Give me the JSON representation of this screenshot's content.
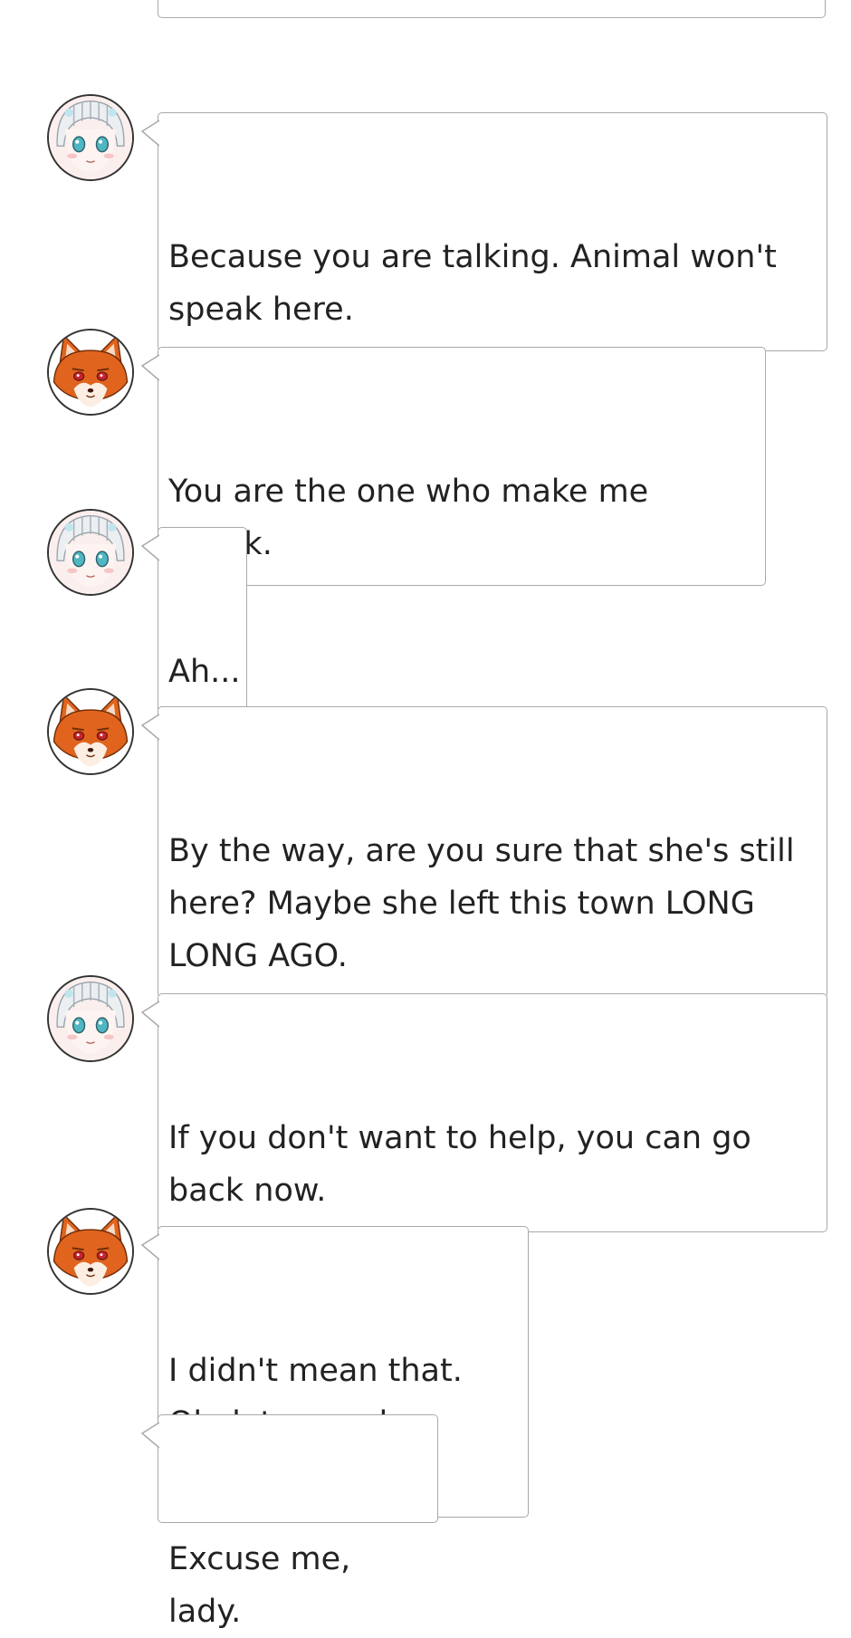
{
  "colors": {
    "bubble_border": "#a9a9a9",
    "text": "#222222",
    "avatar_ring": "#333333",
    "fox_orange": "#e0641e"
  },
  "messages": [
    {
      "speaker": "girl",
      "avatar_icon": "girl-avatar-icon",
      "text": "Because you are talking. Animal won't\nspeak here."
    },
    {
      "speaker": "fox",
      "avatar_icon": "fox-avatar-icon",
      "text": "You are the one who make me speak."
    },
    {
      "speaker": "girl",
      "avatar_icon": "girl-avatar-icon",
      "text": "Ah..."
    },
    {
      "speaker": "fox",
      "avatar_icon": "fox-avatar-icon",
      "text": "By the way, are you sure that she's still\nhere? Maybe she left this town LONG\nLONG AGO."
    },
    {
      "speaker": "girl",
      "avatar_icon": "girl-avatar-icon",
      "text": "If you don't want to help, you can go\nback now."
    },
    {
      "speaker": "fox",
      "avatar_icon": "fox-avatar-icon",
      "text": "I didn't mean that.\nOk, let me ask people."
    },
    {
      "speaker": "none",
      "avatar_icon": "",
      "text": "Excuse me, lady."
    }
  ]
}
